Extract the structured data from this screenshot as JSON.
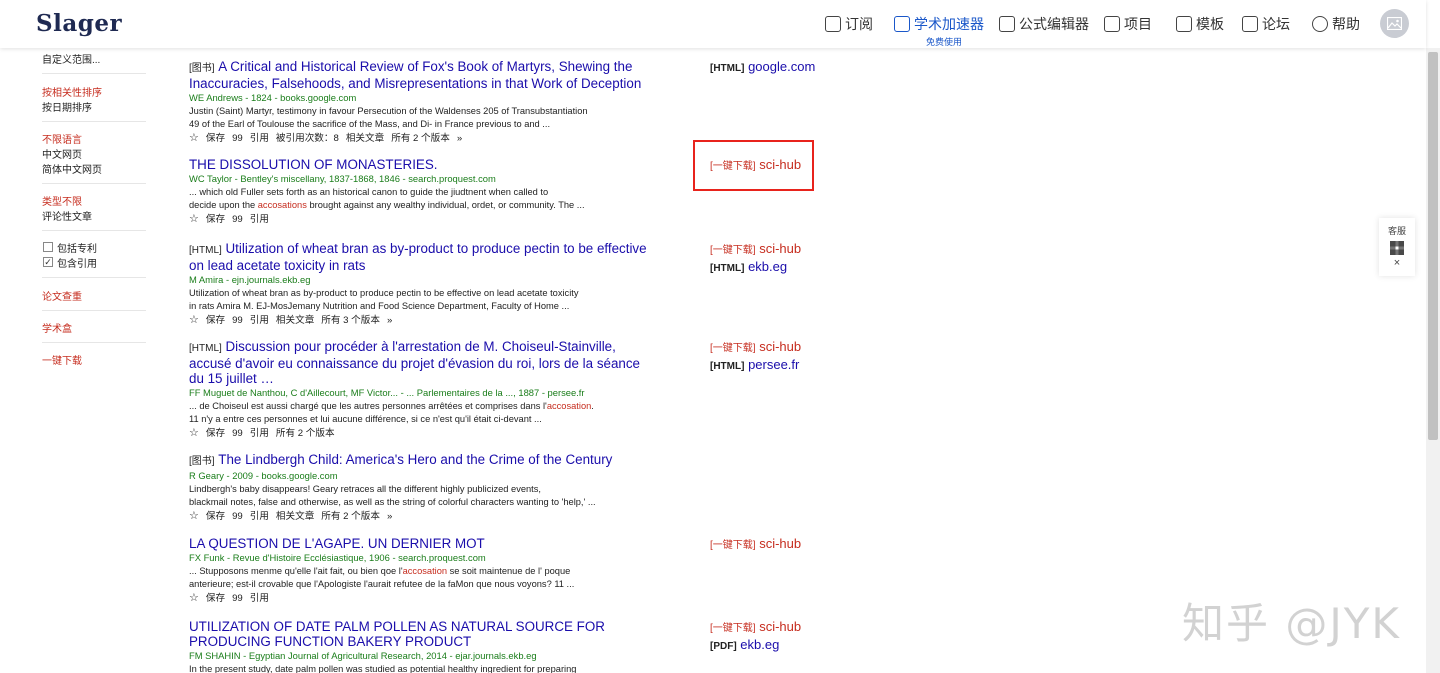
{
  "header": {
    "logo": "Slager",
    "nav": [
      {
        "label": "订阅",
        "icon": "yen-icon"
      },
      {
        "label": "学术加速器",
        "icon": "bolt-icon"
      },
      {
        "label": "公式编辑器",
        "icon": "formula-icon"
      },
      {
        "label": "项目",
        "icon": "folder-icon"
      },
      {
        "label": "模板",
        "icon": "template-icon"
      },
      {
        "label": "论坛",
        "icon": "chat-icon"
      },
      {
        "label": "帮助",
        "icon": "help-icon"
      }
    ],
    "accelerator_sub": "免费使用",
    "avatar_icon": "image-icon"
  },
  "sidebar": {
    "custom_range": "自定义范围...",
    "sort_relevance": "按相关性排序",
    "sort_date": "按日期排序",
    "lang_any": "不限语言",
    "lang_chinese": "中文网页",
    "lang_simplified": "简体中文网页",
    "type_any": "类型不限",
    "type_review": "评论性文章",
    "include_patents": "包括专利",
    "include_citations": "包含引用",
    "plagiarism_check": "论文查重",
    "scholar_box": "学术盒",
    "one_click_download": "一键下载"
  },
  "results": [
    {
      "tag": "[图书]",
      "title": "A Critical and Historical Review of Fox's Book of Martyrs, Shewing the Inaccuracies, Falsehoods, and Misrepresentations in that Work of Deception",
      "authors": "WE Andrews - 1824 - books.google.com",
      "snippet1": "Justin (Saint) Martyr, testimony in favour Persecution of the Waldenses 205 of Transubstantiation",
      "snippet2": "49 of the Earl of Toulouse the sacrifice of the Mass, and Di- in France previous to and ...",
      "actions": [
        "☆",
        "保存",
        "99",
        "引用",
        "被引用次数：8",
        "相关文章",
        "所有 2 个版本",
        "»"
      ],
      "link_type": "[HTML]",
      "link": "google.com"
    },
    {
      "tag": "",
      "title": "THE DISSOLUTION OF MONASTERIES.",
      "authors": "WC Taylor - Bentley's miscellany, 1837-1868, 1846 - search.proquest.com",
      "snippet1": "... which old Fuller sets forth as an historical canon to guide the jiudtnent when called to",
      "snippet2_pre": "decide upon the ",
      "snippet2_hl": "accosations",
      "snippet2_post": " brought against any wealthy individual, ordet, or community. The ...",
      "actions": [
        "☆",
        "保存",
        "99",
        "引用"
      ],
      "link_type": "[一键下载]",
      "link": "sci-hub"
    },
    {
      "tag": "[HTML]",
      "title": "Utilization of wheat bran as by-product to produce pectin to be effective on lead acetate toxicity in rats",
      "authors": "M Amira - ejn.journals.ekb.eg",
      "snippet1": "Utilization of wheat bran as by-product to produce pectin to be effective on lead acetate toxicity",
      "snippet2": "in rats Amira M. EJ-MosJemany Nutrition and Food Science Department, Faculty of Home ...",
      "actions": [
        "☆",
        "保存",
        "99",
        "引用",
        "相关文章",
        "所有 3 个版本",
        "»"
      ],
      "link_type": "[一键下载]",
      "link": "sci-hub",
      "link2_type": "[HTML]",
      "link2": "ekb.eg"
    },
    {
      "tag": "[HTML]",
      "title": "Discussion pour procéder à l'arrestation de M. Choiseul-Stainville, accusé d'avoir eu connaissance du projet d'évasion du roi, lors de la séance du 15 juillet …",
      "authors": "FF Muguet de Nanthou, C d'Aillecourt, MF Victor... - ... Parlementaires de la ..., 1887 - persee.fr",
      "snippet1_pre": "... de Choiseul est aussi chargé que les autres personnes arrêtées et comprises dans l'",
      "snippet1_hl": "accosation",
      "snippet1_post": ".",
      "snippet2": "11 n'y a entre ces personnes et lui aucune différence, si ce n'est qu'il était ci-devant ...",
      "actions": [
        "☆",
        "保存",
        "99",
        "引用",
        "所有 2 个版本"
      ],
      "link_type": "[一键下载]",
      "link": "sci-hub",
      "link2_type": "[HTML]",
      "link2": "persee.fr"
    },
    {
      "tag": "[图书]",
      "title": "The Lindbergh Child: America's Hero and the Crime of the Century",
      "authors": "R Geary - 2009 - books.google.com",
      "snippet1": "Lindbergh's baby disappears! Geary retraces all the different highly publicized events,",
      "snippet2": "blackmail notes, false and otherwise, as well as the string of colorful characters wanting to 'help,' ...",
      "actions": [
        "☆",
        "保存",
        "99",
        "引用",
        "相关文章",
        "所有 2 个版本",
        "»"
      ]
    },
    {
      "tag": "",
      "title": "LA QUESTION DE L'AGAPE. UN DERNIER MOT",
      "authors": "FX Funk - Revue d'Histoire Ecclésiastique, 1906 - search.proquest.com",
      "snippet1_pre": "... Stupposons menme qu'elle l'ait fait, ou bien qoe l'",
      "snippet1_hl": "accosation",
      "snippet1_post": " se soit maintenue de l' poque",
      "snippet2": "anterieure; est-il crovable que l'Apologiste l'aurait refutee de la faMon que nous voyons? 11 ...",
      "actions": [
        "☆",
        "保存",
        "99",
        "引用"
      ],
      "link_type": "[一键下载]",
      "link": "sci-hub"
    },
    {
      "tag": "",
      "title": "UTILIZATION OF DATE PALM POLLEN AS NATURAL SOURCE FOR PRODUCING FUNCTION BAKERY PRODUCT",
      "authors": "FM SHAHIN - Egyptian Journal of Agricultural Research, 2014 - ejar.journals.ekb.eg",
      "snippet1": "In the present study, date palm pollen was studied as potential healthy ingredient for preparing",
      "link_type": "[一键下载]",
      "link": "sci-hub",
      "link2_type": "[PDF]",
      "link2": "ekb.eg"
    }
  ],
  "float_panel": {
    "label": "客服",
    "close": "×"
  },
  "watermark": "知乎 @JYK"
}
